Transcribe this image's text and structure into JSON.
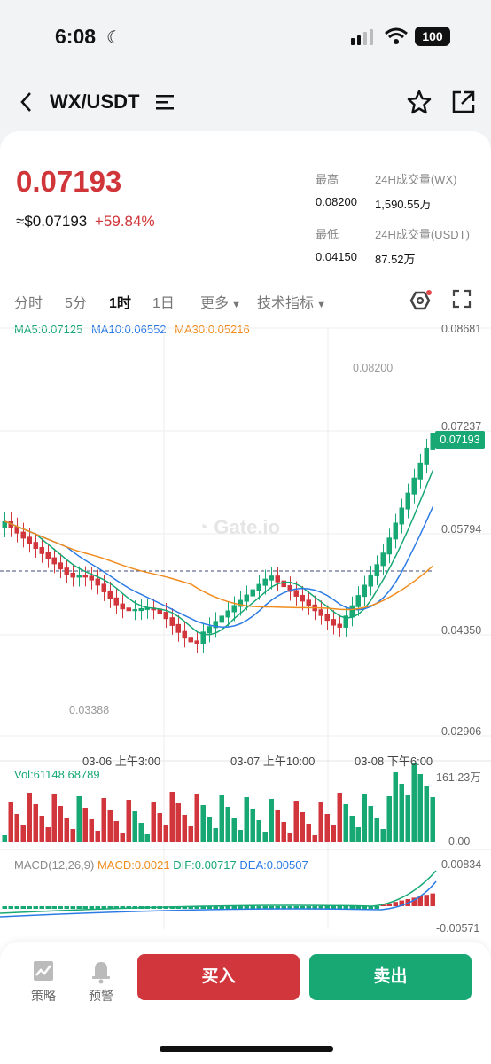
{
  "status": {
    "time": "6:08",
    "battery": "100"
  },
  "header": {
    "pair": "WX/USDT"
  },
  "ticker": {
    "price": "0.07193",
    "usd": "≈$0.07193",
    "change": "+59.84%",
    "high_label": "最高",
    "high": "0.08200",
    "low_label": "最低",
    "low": "0.04150",
    "vol_wx_label": "24H成交量(WX)",
    "vol_wx": "1,590.55万",
    "vol_usdt_label": "24H成交量(USDT)",
    "vol_usdt": "87.52万"
  },
  "tabs": {
    "t1": "分时",
    "t2": "5分",
    "t3": "1时",
    "t4": "1日",
    "more": "更多",
    "indicators": "技术指标"
  },
  "chart": {
    "ma5": "MA5:0.07125",
    "ma10": "MA10:0.06552",
    "ma30": "MA30:0.05216",
    "y_labels": [
      "0.08681",
      "0.07237",
      "0.05794",
      "0.04350",
      "0.02906"
    ],
    "last_price": "0.07193",
    "high_mark": "0.08200",
    "low_mark": "0.03388",
    "watermark": "Gate.io",
    "time_labels": [
      "03-06 上午3:00",
      "03-07 上午10:00",
      "03-08 下午6:00"
    ],
    "vol_label": "Vol:61148.68789",
    "vol_max": "161.23万",
    "vol_zero": "0.00",
    "macd_label": "MACD(12,26,9)",
    "macd_val": "MACD:0.0021",
    "dif": "DIF:0.00717",
    "dea": "DEA:0.00507",
    "macd_max": "0.00834",
    "macd_min": "-0.00571",
    "colors": {
      "up": "#17a874",
      "down": "#d0363c",
      "ma5": "#17a874",
      "ma10": "#2c7be5",
      "ma30": "#f08c1e"
    }
  },
  "bottom": {
    "strategy": "策略",
    "alert": "预警",
    "buy": "买入",
    "sell": "卖出"
  }
}
